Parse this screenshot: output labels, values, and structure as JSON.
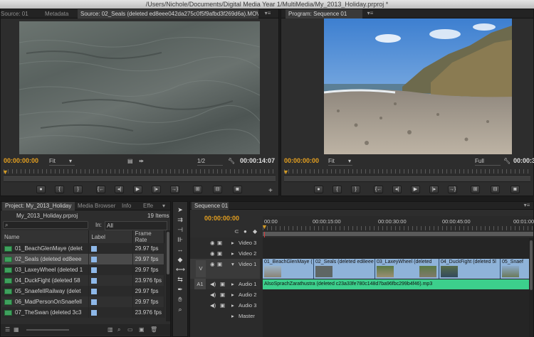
{
  "window": {
    "title": "/Users/Nichole/Documents/Digital Media Year 1/MultiMedia/My_2013_Holiday.prproj *"
  },
  "source_panel": {
    "tabs": [
      "Source: 01",
      "Metadata",
      "Source: 02_Seals (deleted ed8eee042da275c0f5f9afbd3f269d6a).MOV"
    ],
    "timecode_in": "00:00:00:00",
    "zoom": "Fit",
    "resolution": "1/2",
    "duration": "00:00:14:07"
  },
  "program_panel": {
    "tab": "Program: Sequence 01",
    "timecode": "00:00:00:00",
    "zoom": "Fit",
    "resolution": "Full",
    "duration": "00:00:35:09"
  },
  "project_panel": {
    "tabs": [
      "Project: My_2013_Holiday",
      "Media Browser",
      "Info",
      "Effe"
    ],
    "file": "My_2013_Holiday.prproj",
    "item_count": "19 Items",
    "in_label": "In:",
    "in_value": "All",
    "columns": [
      "Name",
      "Label",
      "Frame Rate"
    ],
    "rows": [
      {
        "name": "01_BeachGlenMaye (delet",
        "rate": "29.97 fps"
      },
      {
        "name": "02_Seals (deleted ed8eee",
        "rate": "29.97 fps"
      },
      {
        "name": "03_LaxeyWheel (deleted 1",
        "rate": "29.97 fps"
      },
      {
        "name": "04_DuckFight (deleted 58",
        "rate": "23.976 fps"
      },
      {
        "name": "05_SnaefellRailway (delet",
        "rate": "29.97 fps"
      },
      {
        "name": "06_MadPersonOnSnaefell",
        "rate": "29.97 fps"
      },
      {
        "name": "07_TheSwan (deleted 3c3",
        "rate": "23.976 fps"
      }
    ]
  },
  "sequence_panel": {
    "tab": "Sequence 01",
    "timecode": "00:00:00:00",
    "ruler": [
      "00:00",
      "00:00:15:00",
      "00:00:30:00",
      "00:00:45:00",
      "00:01:00"
    ],
    "tracks": [
      {
        "label": "Video 3"
      },
      {
        "label": "Video 2"
      },
      {
        "label": "Video 1",
        "side": "V"
      },
      {
        "label": "Audio 1",
        "side": "A1"
      },
      {
        "label": "Audio 2"
      },
      {
        "label": "Audio 3"
      },
      {
        "label": "Master"
      }
    ],
    "video_clips": [
      "01_BeachGlenMaye (",
      "02_Seals (deleted ed8eee",
      "03_LaxeyWheel (deleted",
      "04_DuckFight (deleted 5l",
      "05_Snaef"
    ],
    "audio_clip": "AlsoSprachZarathustra (deleted c23a33fe780c148d7ba96fbc299b4f46).mp3"
  }
}
